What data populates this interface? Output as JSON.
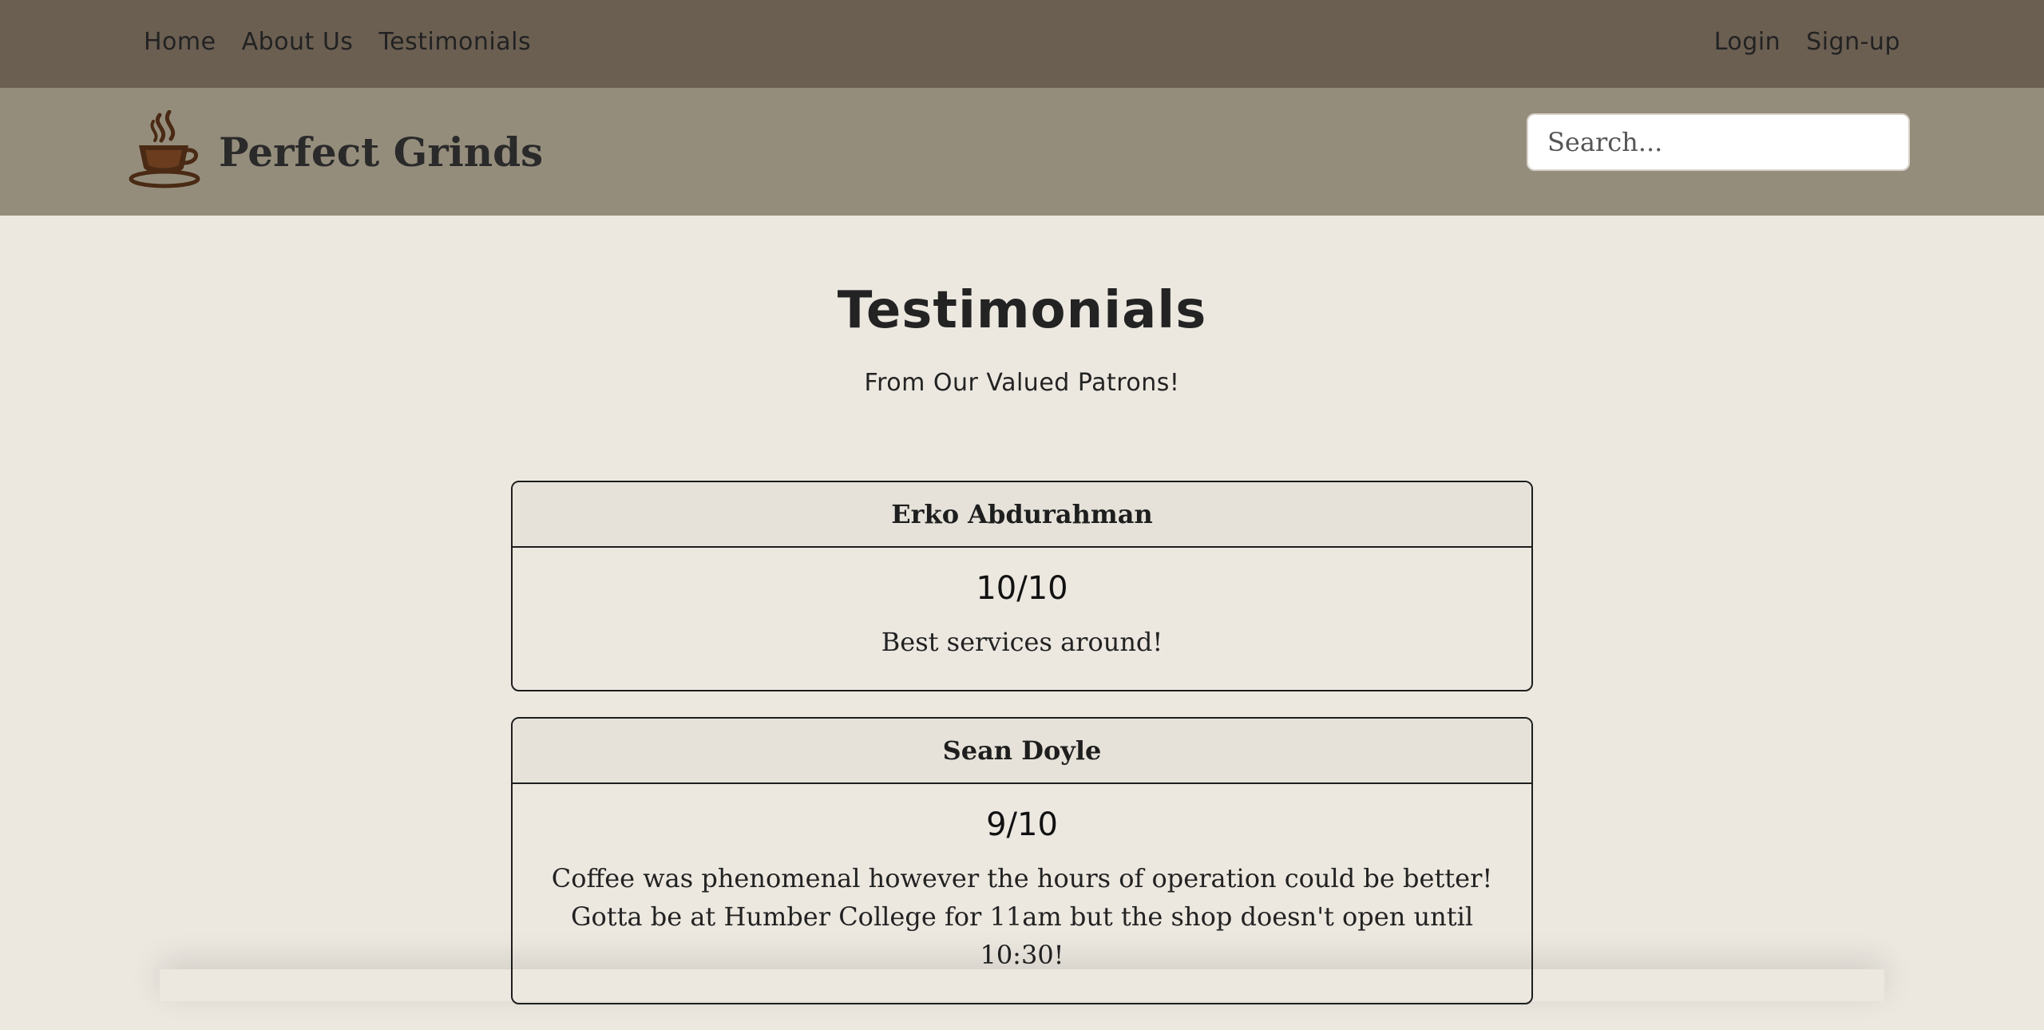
{
  "top_nav": {
    "left_links": [
      "Home",
      "About Us",
      "Testimonials"
    ],
    "right_links": [
      "Login",
      "Sign-up"
    ]
  },
  "brand": {
    "logo_icon": "coffee-cup-icon",
    "name": "Perfect Grinds"
  },
  "search": {
    "placeholder": "Search..."
  },
  "page": {
    "title": "Testimonials",
    "subtitle": "From Our Valued Patrons!"
  },
  "testimonials": [
    {
      "name": "Erko Abdurahman",
      "rating": "10/10",
      "comment": "Best services around!"
    },
    {
      "name": "Sean Doyle",
      "rating": "9/10",
      "comment": "Coffee was phenomenal however the hours of operation could be better! Gotta be at Humber College for 11am but the shop doesn't open until 10:30!"
    }
  ],
  "colors": {
    "top_nav_bg": "#6b5f52",
    "brand_bar_bg": "#958d7c",
    "page_bg": "#ece8e0",
    "card_header_bg": "#e6e2da"
  }
}
